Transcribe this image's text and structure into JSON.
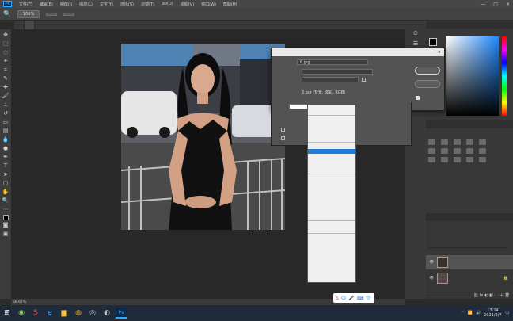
{
  "menubar": {
    "logo": "Ps",
    "items": [
      "文件(F)",
      "编辑(E)",
      "图像(I)",
      "图层(L)",
      "文字(Y)",
      "选择(S)",
      "滤镜(T)",
      "3D(D)",
      "视图(V)",
      "窗口(W)",
      "帮助(H)"
    ]
  },
  "options": {
    "btn1": "100%",
    "btn2": "",
    "btn3": ""
  },
  "tabs": [
    {
      "label": "",
      "active": false
    },
    {
      "label": "",
      "active": true
    }
  ],
  "statusbar": {
    "zoom": "66.67%"
  },
  "colors": {
    "accent": "#1e7ad8",
    "ps_blue": "#31a8ff",
    "panel_bg": "#383838"
  },
  "panel": {
    "tab_color": "",
    "tab_swatches": "",
    "tab_adjustments": "",
    "tab_layers": "",
    "tab_channels": "",
    "tab_paths": "",
    "layers": [
      {
        "name": ""
      },
      {
        "name": ""
      }
    ]
  },
  "dialog": {
    "title": "",
    "close": "×",
    "source_label": "",
    "source_value": "6.jpg",
    "layer_label": "",
    "layer_value": "",
    "channel_label": "",
    "channel_value": "",
    "invert_label": "",
    "target_label": "",
    "target_value": "6.jpg (背景, 泼彩, RGB)",
    "blend_label": "",
    "blend_value": "",
    "opacity_label": "",
    "preserve_label": "",
    "mask_label": "",
    "ok": "",
    "cancel": "",
    "preview": ""
  },
  "blend_modes": {
    "group1": [
      "",
      ""
    ],
    "group2": [
      "",
      "",
      "",
      ""
    ],
    "group3": [
      "",
      "",
      "",
      "",
      ""
    ],
    "group4": [
      "",
      "",
      "",
      "",
      "",
      "",
      "",
      "",
      ""
    ],
    "group5": [
      "",
      ""
    ],
    "group6": [
      "",
      "",
      ""
    ],
    "selected_index": 6
  },
  "taskbar": {
    "time": "13:24",
    "date": "2021/2/7"
  }
}
